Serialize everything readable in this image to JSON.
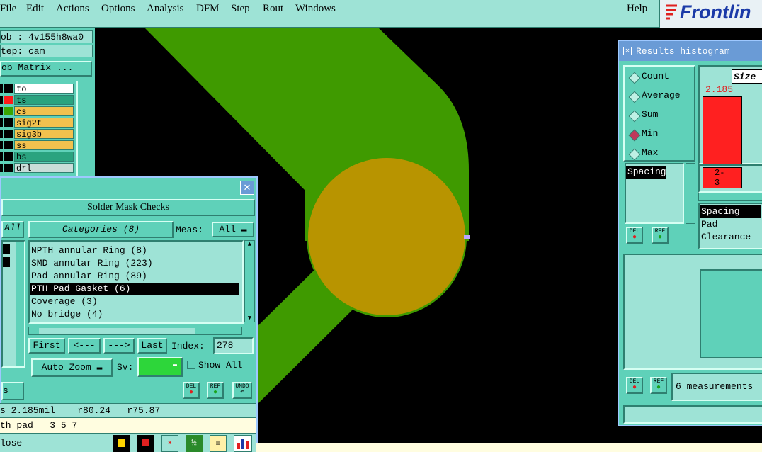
{
  "menu": {
    "items": [
      "File",
      "Edit",
      "Actions",
      "Options",
      "Analysis",
      "DFM",
      "Step",
      "Rout",
      "Windows"
    ],
    "help": "Help",
    "brand": "Frontlin"
  },
  "left_panel": {
    "job": "ob : 4v155h8wa0",
    "step": "tep: cam",
    "job_matrix": "ob Matrix ...",
    "layers": [
      {
        "name": "to",
        "color": "#ffffff",
        "box": "#000000"
      },
      {
        "name": "ts",
        "color": "#2aa37f",
        "box": "#ff1a1a"
      },
      {
        "name": "cs",
        "color": "#f2c14e",
        "box": "#39a500"
      },
      {
        "name": "sig2t",
        "color": "#f2c14e",
        "box": "#000000"
      },
      {
        "name": "sig3b",
        "color": "#f2c14e",
        "box": "#000000"
      },
      {
        "name": "ss",
        "color": "#f2c14e",
        "box": "#000000"
      },
      {
        "name": "bs",
        "color": "#2aa37f",
        "box": "#000000"
      },
      {
        "name": "drl",
        "color": "#c9ddd9",
        "box": "#000000"
      }
    ]
  },
  "solder_mask": {
    "title": "Solder Mask Checks",
    "all_label": "All",
    "categories_label": "Categories (8)",
    "meas_label": "Meas:",
    "meas_value": "All",
    "items": [
      "NPTH annular Ring (8)",
      "SMD annular Ring (223)",
      "Pad annular Ring (89)",
      "PTH Pad Gasket (6)",
      "Coverage (3)",
      "No bridge (4)"
    ],
    "selected_index": 3,
    "first": "First",
    "prev": "<---",
    "next": "--->",
    "last": "Last",
    "index_label": "Index:",
    "index_value": "278",
    "auto_zoom": "Auto Zoom",
    "sv_label": "Sv:",
    "show_all": "Show All",
    "del": "DEL",
    "ref": "REF",
    "undo": "UNDO",
    "s_label": "s"
  },
  "status": {
    "line1": "s 2.185mil    r80.24   r75.87",
    "line2": "th_pad = 3 5 7",
    "close": "lose"
  },
  "histogram": {
    "title": "Results histogram",
    "modes": [
      "Count",
      "Average",
      "Sum",
      "Min",
      "Max"
    ],
    "selected_mode": "Min",
    "list": [
      "Spacing"
    ],
    "size_label": "Size",
    "bar_value": "2.185",
    "small_bar_label": "2-\n3",
    "legend": [
      "Spacing",
      "Pad",
      "Clearance"
    ],
    "del": "DEL",
    "ref": "REF",
    "measurements": "6 measurements"
  },
  "colors": {
    "copper_green": "#3f9a00",
    "pad_gold": "#b89400",
    "panel_teal": "#5fd1b9",
    "bar_red": "#ff2020"
  }
}
